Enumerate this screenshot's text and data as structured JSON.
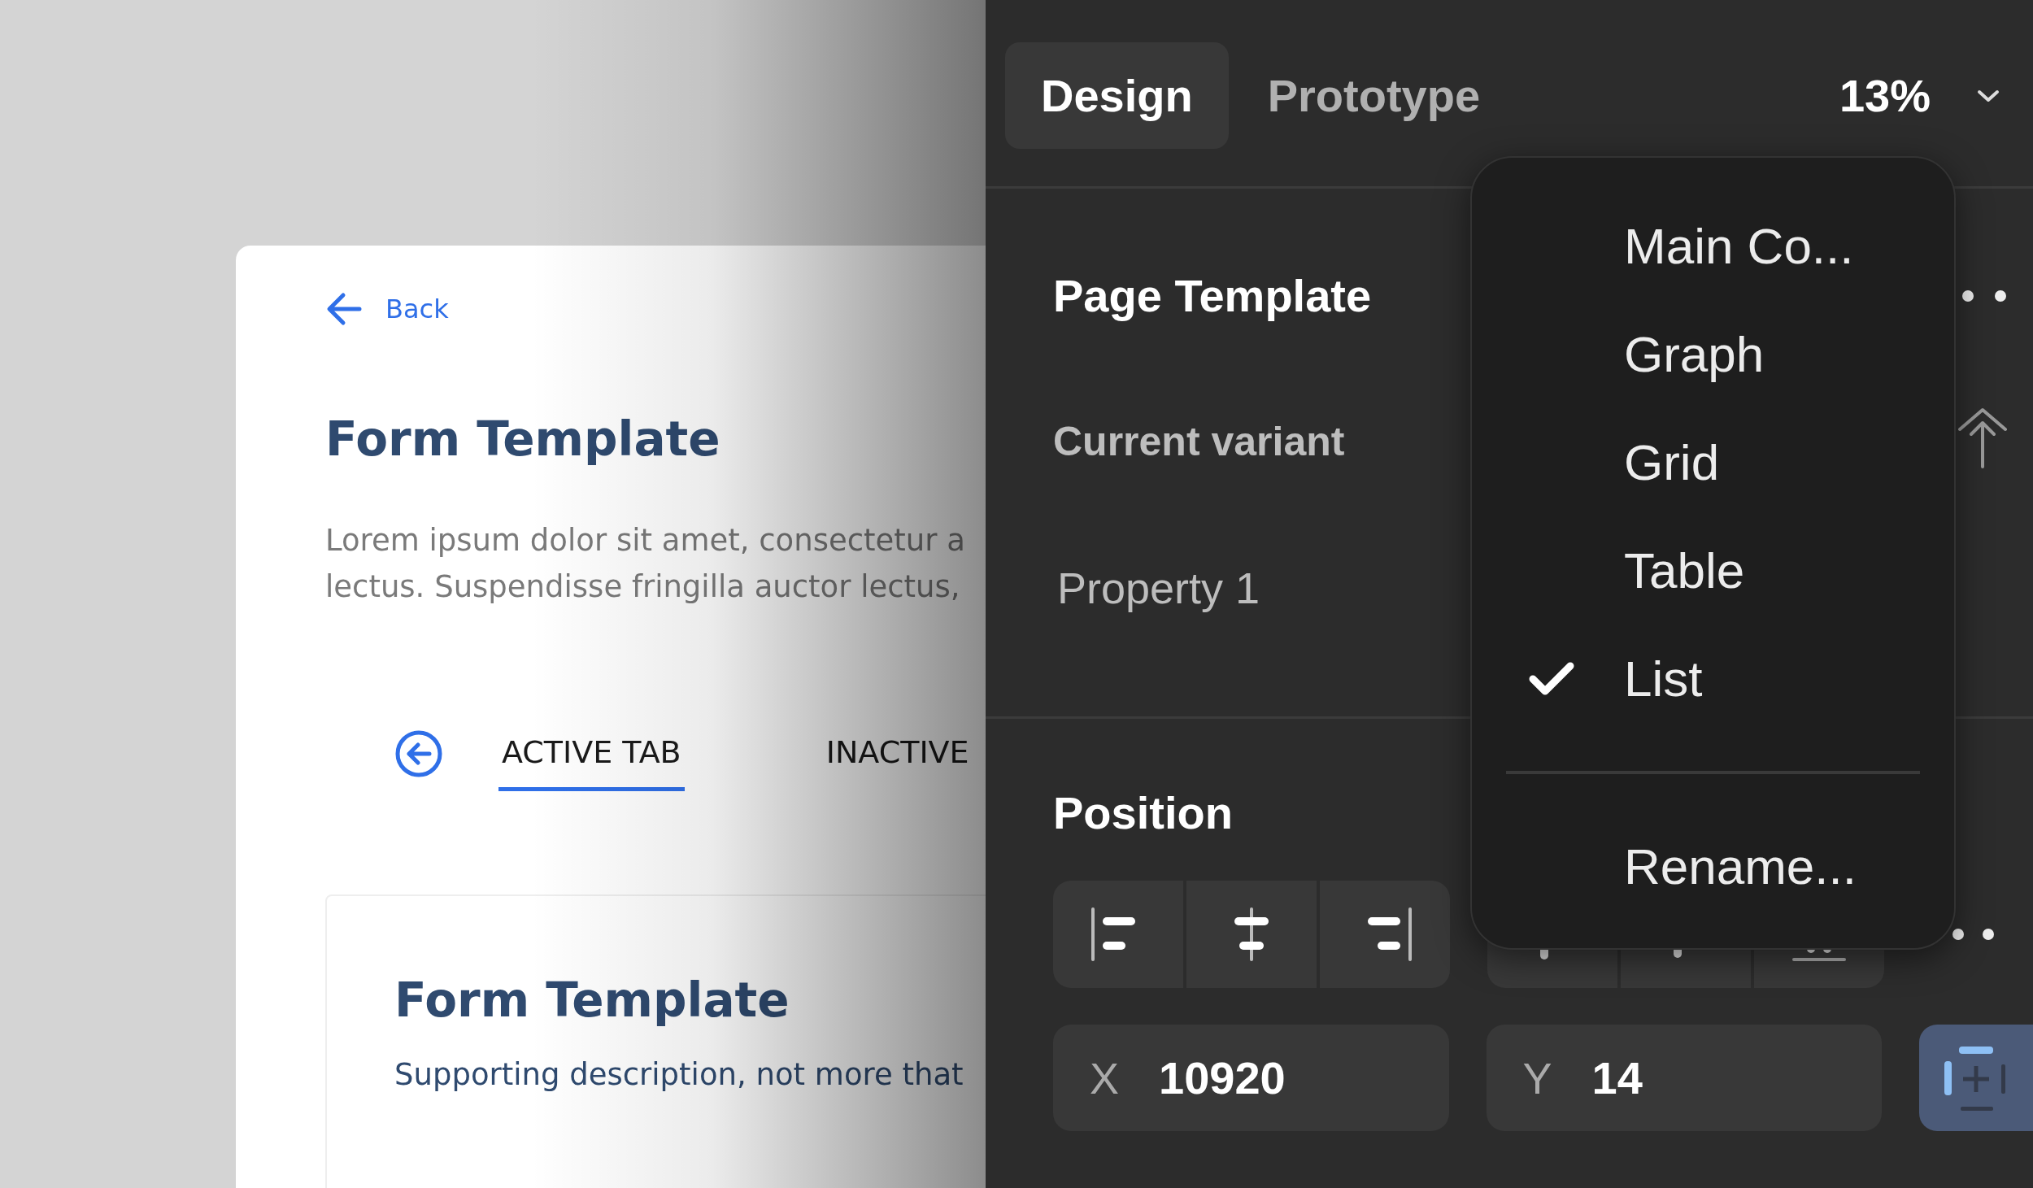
{
  "canvas": {
    "back_link": "Back",
    "title": "Form Template",
    "description_lines": [
      "Lorem ipsum dolor sit amet, consectetur a",
      "lectus. Suspendisse fringilla auctor lectus,"
    ],
    "tabs": [
      {
        "label": "ACTIVE TAB",
        "selected": true
      },
      {
        "label": "INACTIVE",
        "selected": false
      }
    ],
    "card": {
      "title": "Form Template",
      "description": "Supporting description, not more that"
    }
  },
  "panel": {
    "tabs": [
      {
        "label": "Design",
        "selected": true
      },
      {
        "label": "Prototype",
        "selected": false
      }
    ],
    "zoom": "13%",
    "component": {
      "title": "Page Template",
      "variant_label": "Current variant",
      "property": "Property 1"
    },
    "position": {
      "title": "Position",
      "fields": [
        {
          "label": "X",
          "value": "10920"
        },
        {
          "label": "Y",
          "value": "14"
        }
      ]
    }
  },
  "menu": {
    "options": [
      {
        "label": "Main Co...",
        "selected": false
      },
      {
        "label": "Graph",
        "selected": false
      },
      {
        "label": "Grid",
        "selected": false
      },
      {
        "label": "Table",
        "selected": false
      },
      {
        "label": "List",
        "selected": true
      }
    ],
    "actions": [
      "Rename..."
    ]
  }
}
